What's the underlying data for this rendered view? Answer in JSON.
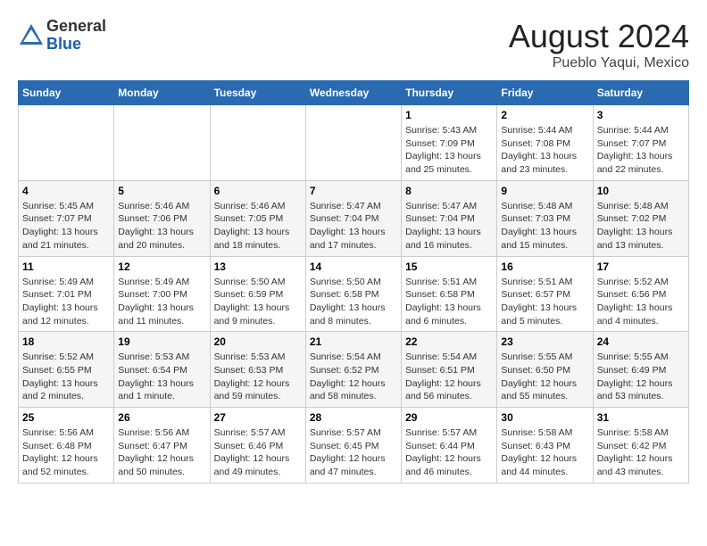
{
  "header": {
    "logo": {
      "general": "General",
      "blue": "Blue"
    },
    "title": "August 2024",
    "location": "Pueblo Yaqui, Mexico"
  },
  "weekdays": [
    "Sunday",
    "Monday",
    "Tuesday",
    "Wednesday",
    "Thursday",
    "Friday",
    "Saturday"
  ],
  "weeks": [
    [
      {
        "day": "",
        "sunrise": "",
        "sunset": "",
        "daylight": ""
      },
      {
        "day": "",
        "sunrise": "",
        "sunset": "",
        "daylight": ""
      },
      {
        "day": "",
        "sunrise": "",
        "sunset": "",
        "daylight": ""
      },
      {
        "day": "",
        "sunrise": "",
        "sunset": "",
        "daylight": ""
      },
      {
        "day": "1",
        "sunrise": "Sunrise: 5:43 AM",
        "sunset": "Sunset: 7:09 PM",
        "daylight": "Daylight: 13 hours and 25 minutes."
      },
      {
        "day": "2",
        "sunrise": "Sunrise: 5:44 AM",
        "sunset": "Sunset: 7:08 PM",
        "daylight": "Daylight: 13 hours and 23 minutes."
      },
      {
        "day": "3",
        "sunrise": "Sunrise: 5:44 AM",
        "sunset": "Sunset: 7:07 PM",
        "daylight": "Daylight: 13 hours and 22 minutes."
      }
    ],
    [
      {
        "day": "4",
        "sunrise": "Sunrise: 5:45 AM",
        "sunset": "Sunset: 7:07 PM",
        "daylight": "Daylight: 13 hours and 21 minutes."
      },
      {
        "day": "5",
        "sunrise": "Sunrise: 5:46 AM",
        "sunset": "Sunset: 7:06 PM",
        "daylight": "Daylight: 13 hours and 20 minutes."
      },
      {
        "day": "6",
        "sunrise": "Sunrise: 5:46 AM",
        "sunset": "Sunset: 7:05 PM",
        "daylight": "Daylight: 13 hours and 18 minutes."
      },
      {
        "day": "7",
        "sunrise": "Sunrise: 5:47 AM",
        "sunset": "Sunset: 7:04 PM",
        "daylight": "Daylight: 13 hours and 17 minutes."
      },
      {
        "day": "8",
        "sunrise": "Sunrise: 5:47 AM",
        "sunset": "Sunset: 7:04 PM",
        "daylight": "Daylight: 13 hours and 16 minutes."
      },
      {
        "day": "9",
        "sunrise": "Sunrise: 5:48 AM",
        "sunset": "Sunset: 7:03 PM",
        "daylight": "Daylight: 13 hours and 15 minutes."
      },
      {
        "day": "10",
        "sunrise": "Sunrise: 5:48 AM",
        "sunset": "Sunset: 7:02 PM",
        "daylight": "Daylight: 13 hours and 13 minutes."
      }
    ],
    [
      {
        "day": "11",
        "sunrise": "Sunrise: 5:49 AM",
        "sunset": "Sunset: 7:01 PM",
        "daylight": "Daylight: 13 hours and 12 minutes."
      },
      {
        "day": "12",
        "sunrise": "Sunrise: 5:49 AM",
        "sunset": "Sunset: 7:00 PM",
        "daylight": "Daylight: 13 hours and 11 minutes."
      },
      {
        "day": "13",
        "sunrise": "Sunrise: 5:50 AM",
        "sunset": "Sunset: 6:59 PM",
        "daylight": "Daylight: 13 hours and 9 minutes."
      },
      {
        "day": "14",
        "sunrise": "Sunrise: 5:50 AM",
        "sunset": "Sunset: 6:58 PM",
        "daylight": "Daylight: 13 hours and 8 minutes."
      },
      {
        "day": "15",
        "sunrise": "Sunrise: 5:51 AM",
        "sunset": "Sunset: 6:58 PM",
        "daylight": "Daylight: 13 hours and 6 minutes."
      },
      {
        "day": "16",
        "sunrise": "Sunrise: 5:51 AM",
        "sunset": "Sunset: 6:57 PM",
        "daylight": "Daylight: 13 hours and 5 minutes."
      },
      {
        "day": "17",
        "sunrise": "Sunrise: 5:52 AM",
        "sunset": "Sunset: 6:56 PM",
        "daylight": "Daylight: 13 hours and 4 minutes."
      }
    ],
    [
      {
        "day": "18",
        "sunrise": "Sunrise: 5:52 AM",
        "sunset": "Sunset: 6:55 PM",
        "daylight": "Daylight: 13 hours and 2 minutes."
      },
      {
        "day": "19",
        "sunrise": "Sunrise: 5:53 AM",
        "sunset": "Sunset: 6:54 PM",
        "daylight": "Daylight: 13 hours and 1 minute."
      },
      {
        "day": "20",
        "sunrise": "Sunrise: 5:53 AM",
        "sunset": "Sunset: 6:53 PM",
        "daylight": "Daylight: 12 hours and 59 minutes."
      },
      {
        "day": "21",
        "sunrise": "Sunrise: 5:54 AM",
        "sunset": "Sunset: 6:52 PM",
        "daylight": "Daylight: 12 hours and 58 minutes."
      },
      {
        "day": "22",
        "sunrise": "Sunrise: 5:54 AM",
        "sunset": "Sunset: 6:51 PM",
        "daylight": "Daylight: 12 hours and 56 minutes."
      },
      {
        "day": "23",
        "sunrise": "Sunrise: 5:55 AM",
        "sunset": "Sunset: 6:50 PM",
        "daylight": "Daylight: 12 hours and 55 minutes."
      },
      {
        "day": "24",
        "sunrise": "Sunrise: 5:55 AM",
        "sunset": "Sunset: 6:49 PM",
        "daylight": "Daylight: 12 hours and 53 minutes."
      }
    ],
    [
      {
        "day": "25",
        "sunrise": "Sunrise: 5:56 AM",
        "sunset": "Sunset: 6:48 PM",
        "daylight": "Daylight: 12 hours and 52 minutes."
      },
      {
        "day": "26",
        "sunrise": "Sunrise: 5:56 AM",
        "sunset": "Sunset: 6:47 PM",
        "daylight": "Daylight: 12 hours and 50 minutes."
      },
      {
        "day": "27",
        "sunrise": "Sunrise: 5:57 AM",
        "sunset": "Sunset: 6:46 PM",
        "daylight": "Daylight: 12 hours and 49 minutes."
      },
      {
        "day": "28",
        "sunrise": "Sunrise: 5:57 AM",
        "sunset": "Sunset: 6:45 PM",
        "daylight": "Daylight: 12 hours and 47 minutes."
      },
      {
        "day": "29",
        "sunrise": "Sunrise: 5:57 AM",
        "sunset": "Sunset: 6:44 PM",
        "daylight": "Daylight: 12 hours and 46 minutes."
      },
      {
        "day": "30",
        "sunrise": "Sunrise: 5:58 AM",
        "sunset": "Sunset: 6:43 PM",
        "daylight": "Daylight: 12 hours and 44 minutes."
      },
      {
        "day": "31",
        "sunrise": "Sunrise: 5:58 AM",
        "sunset": "Sunset: 6:42 PM",
        "daylight": "Daylight: 12 hours and 43 minutes."
      }
    ]
  ]
}
